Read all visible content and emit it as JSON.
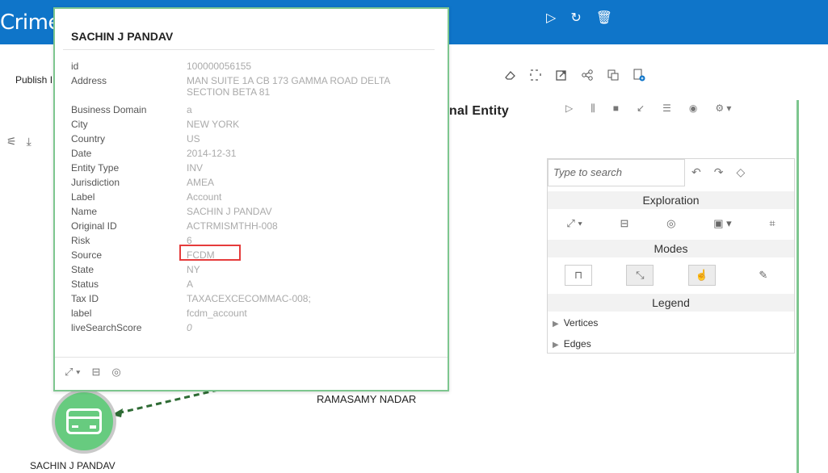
{
  "header": {
    "title": "Crime",
    "run_icon": "▷",
    "refresh_icon": "↻",
    "delete_icon": "🗑"
  },
  "toolbar": {
    "publish_label": "Publish I",
    "icons": [
      "eraser-icon",
      "select-icon",
      "external-link-icon",
      "share-icon",
      "copy-icon",
      "add-doc-icon"
    ]
  },
  "canvas": {
    "heading": "nal Entity",
    "node1_label": "SACHIN J PANDAV",
    "node2_label": "RAMASAMY NADAR"
  },
  "popup": {
    "title": "SACHIN J PANDAV",
    "properties": [
      {
        "key": "id",
        "value": "100000056155"
      },
      {
        "key": "Address",
        "value": "MAN SUITE 1A CB 173 GAMMA ROAD DELTA SECTION BETA 81"
      },
      {
        "key": "Business Domain",
        "value": "a"
      },
      {
        "key": "City",
        "value": "NEW YORK"
      },
      {
        "key": "Country",
        "value": "US"
      },
      {
        "key": "Date",
        "value": "2014-12-31"
      },
      {
        "key": "Entity Type",
        "value": "INV"
      },
      {
        "key": "Jurisdiction",
        "value": "AMEA"
      },
      {
        "key": "Label",
        "value": "Account"
      },
      {
        "key": "Name",
        "value": "SACHIN J PANDAV"
      },
      {
        "key": "Original ID",
        "value": "ACTRMISMTHH-008"
      },
      {
        "key": "Risk",
        "value": "6"
      },
      {
        "key": "Source",
        "value": "FCDM"
      },
      {
        "key": "State",
        "value": "NY"
      },
      {
        "key": "Status",
        "value": "A"
      },
      {
        "key": "Tax ID",
        "value": "TAXACEXCECOMMAC-008;"
      },
      {
        "key": "label",
        "value": "fcdm_account"
      },
      {
        "key": "liveSearchScore",
        "value": "0"
      }
    ]
  },
  "explore_panel": {
    "search_placeholder": "Type to search",
    "exploration_label": "Exploration",
    "modes_label": "Modes",
    "legend_label": "Legend",
    "vertices_label": "Vertices",
    "edges_label": "Edges"
  },
  "colors": {
    "header_bg": "#0f75c9",
    "node_fill": "#67cb7f",
    "edge_color": "#2e6b34",
    "highlight": "#e53b3b"
  }
}
